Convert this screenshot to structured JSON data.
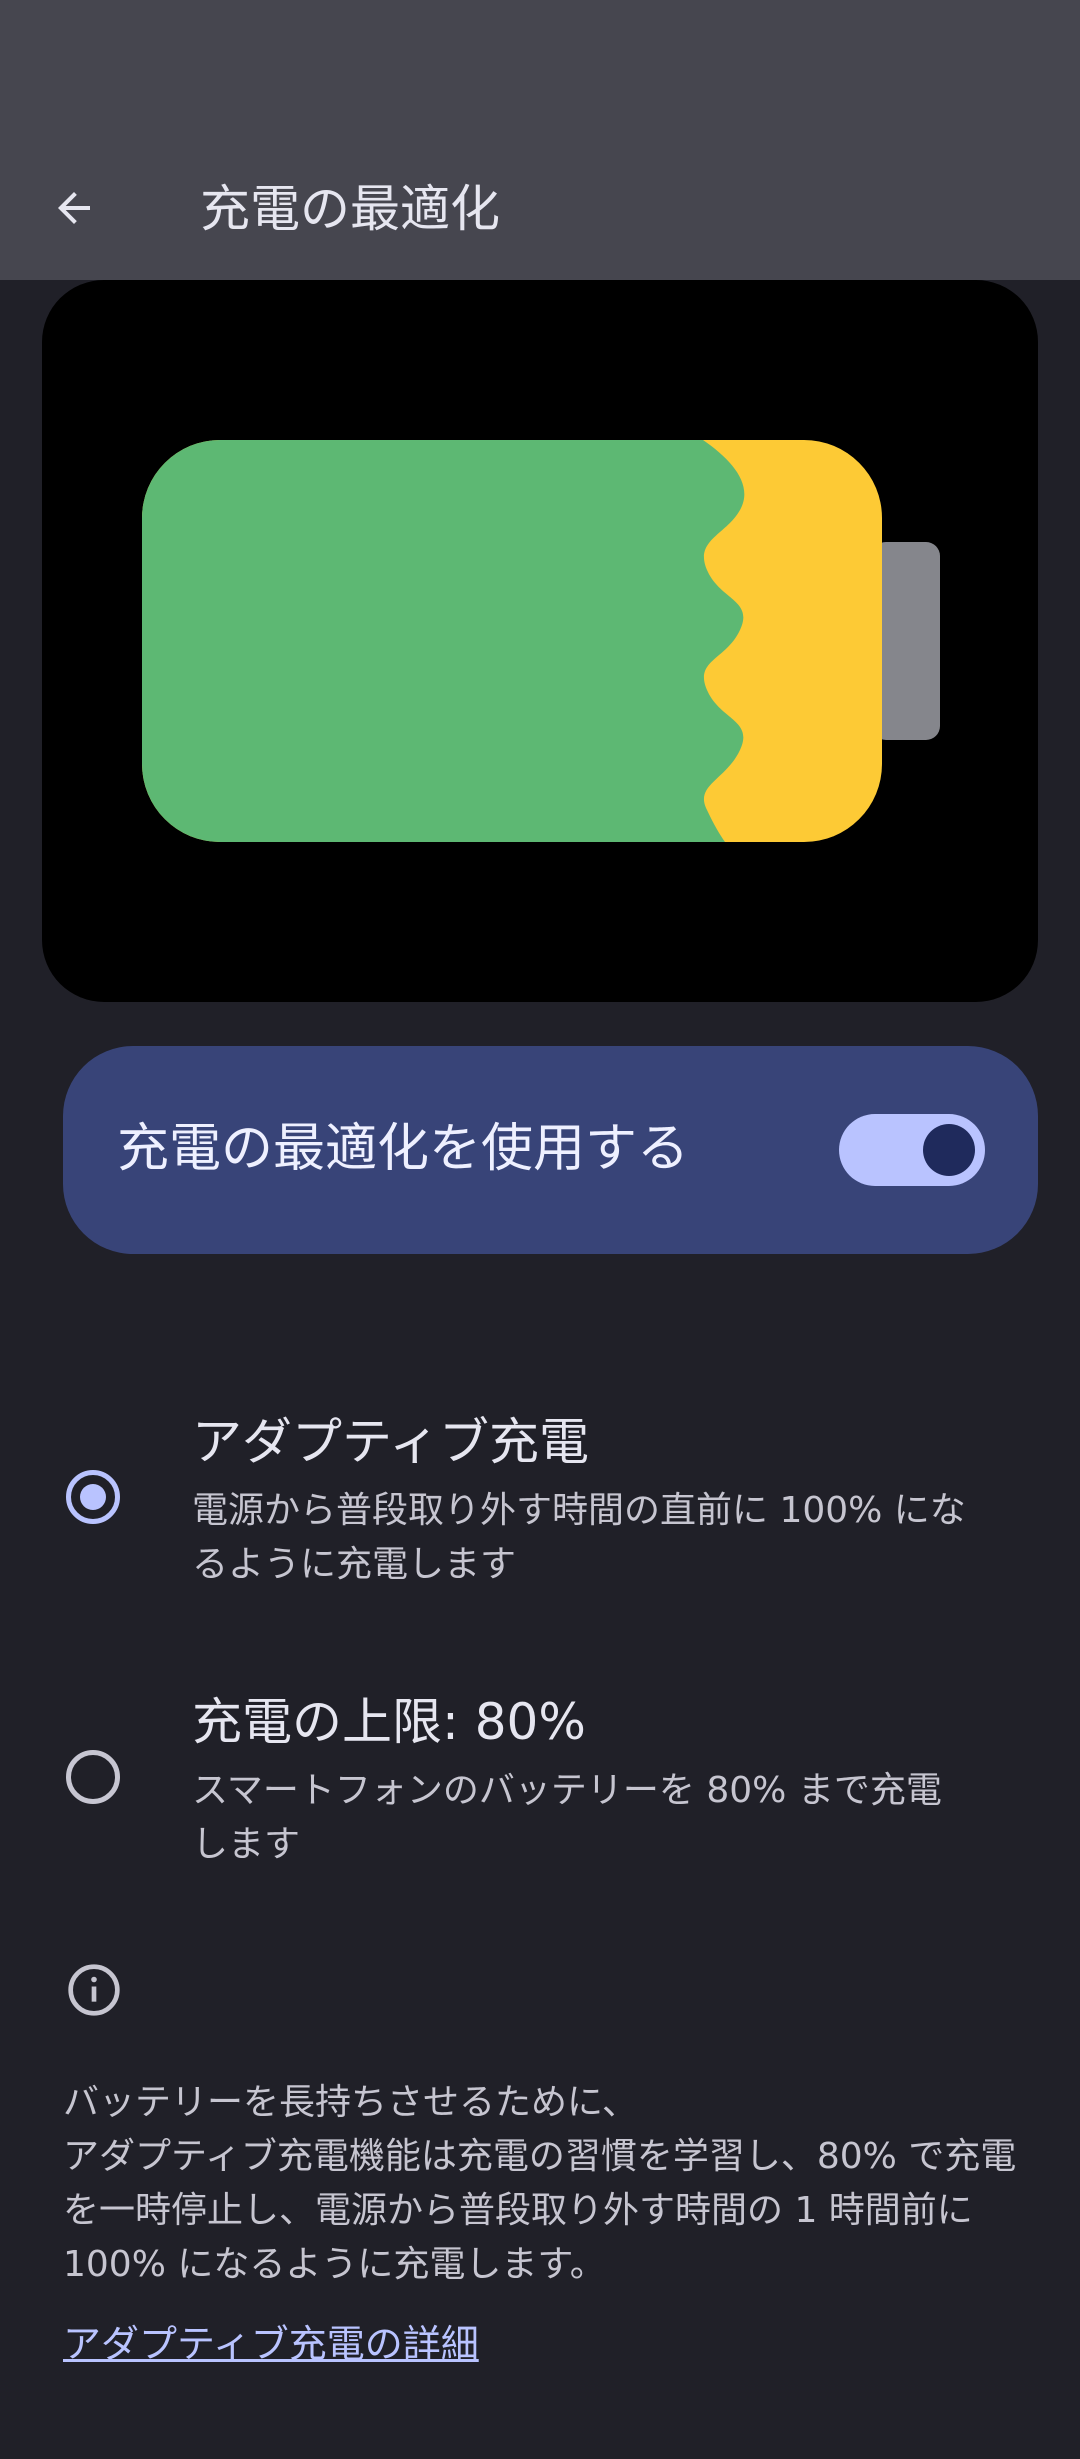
{
  "app_bar": {
    "title": "充電の最適化"
  },
  "colors": {
    "app_bar_bg": "#46464f",
    "page_bg": "#202028",
    "card_bg": "#384478",
    "accent": "#b9c3ff",
    "battery_green": "#5db873",
    "battery_yellow": "#fdca35",
    "battery_terminal": "#85868c"
  },
  "main_toggle": {
    "label": "充電の最適化を使用する",
    "checked": true
  },
  "options": [
    {
      "title": "アダプティブ充電",
      "description": "電源から普段取り外す時間の直前に 100% になるように充電します",
      "selected": true
    },
    {
      "title": "充電の上限: 80%",
      "description": "スマートフォンのバッテリーを 80% まで充電します",
      "selected": false
    }
  ],
  "info": {
    "text": "バッテリーを長持ちさせるために、\nアダプティブ充電機能は充電の習慣を学習し、80% で充電を一時停止し、電源から普段取り外す時間の 1 時間前に 100% になるように充電します。",
    "link_label": "アダプティブ充電の詳細"
  },
  "icons": {
    "back": "arrow-back-icon",
    "info": "info-icon"
  }
}
